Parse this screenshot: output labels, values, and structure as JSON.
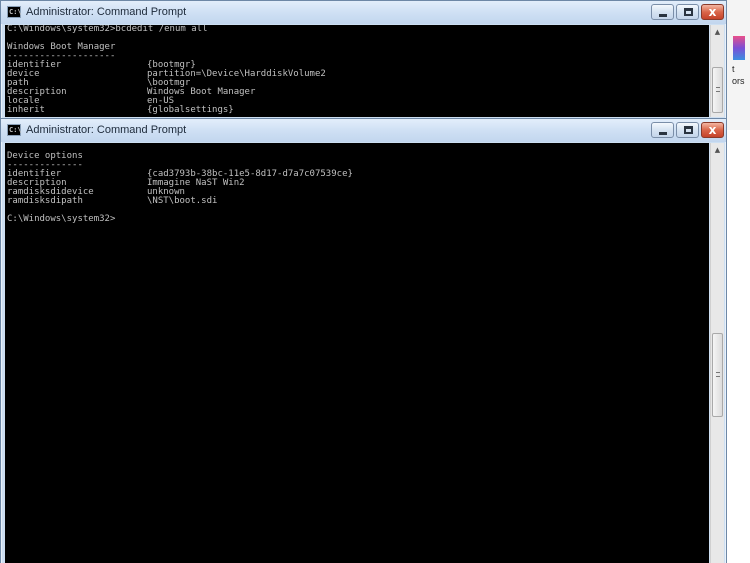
{
  "background_app": {
    "fragments": [
      "t",
      "ors"
    ]
  },
  "windows": [
    {
      "title": "Administrator: Command Prompt",
      "icon_text": "C:\\",
      "lines": [
        {
          "text": "C:\\Windows\\system32>bcdedit /enum all"
        },
        {
          "text": ""
        },
        {
          "text": "Windows Boot Manager"
        },
        {
          "text": "--------------------"
        },
        {
          "key": "identifier",
          "value": "{bootmgr}"
        },
        {
          "key": "device",
          "value": "partition=\\Device\\HarddiskVolume2"
        },
        {
          "key": "path",
          "value": "\\bootmgr"
        },
        {
          "key": "description",
          "value": "Windows Boot Manager"
        },
        {
          "key": "locale",
          "value": "en-US"
        },
        {
          "key": "inherit",
          "value": "{globalsettings}"
        }
      ]
    },
    {
      "title": "Administrator: Command Prompt",
      "icon_text": "C:\\",
      "lines": [
        {
          "text": ""
        },
        {
          "text": "Device options"
        },
        {
          "text": "--------------"
        },
        {
          "key": "identifier",
          "value": "{cad3793b-38bc-11e5-8d17-d7a7c07539ce}"
        },
        {
          "key": "description",
          "value": "Immagine NaST Win2"
        },
        {
          "key": "ramdisksdidevice",
          "value": "unknown"
        },
        {
          "key": "ramdisksdipath",
          "value": "\\NST\\boot.sdi"
        },
        {
          "text": ""
        },
        {
          "text": "C:\\Windows\\system32>"
        }
      ]
    }
  ],
  "controls": {
    "close_glyph": "x",
    "scroll_up_glyph": "▲"
  }
}
